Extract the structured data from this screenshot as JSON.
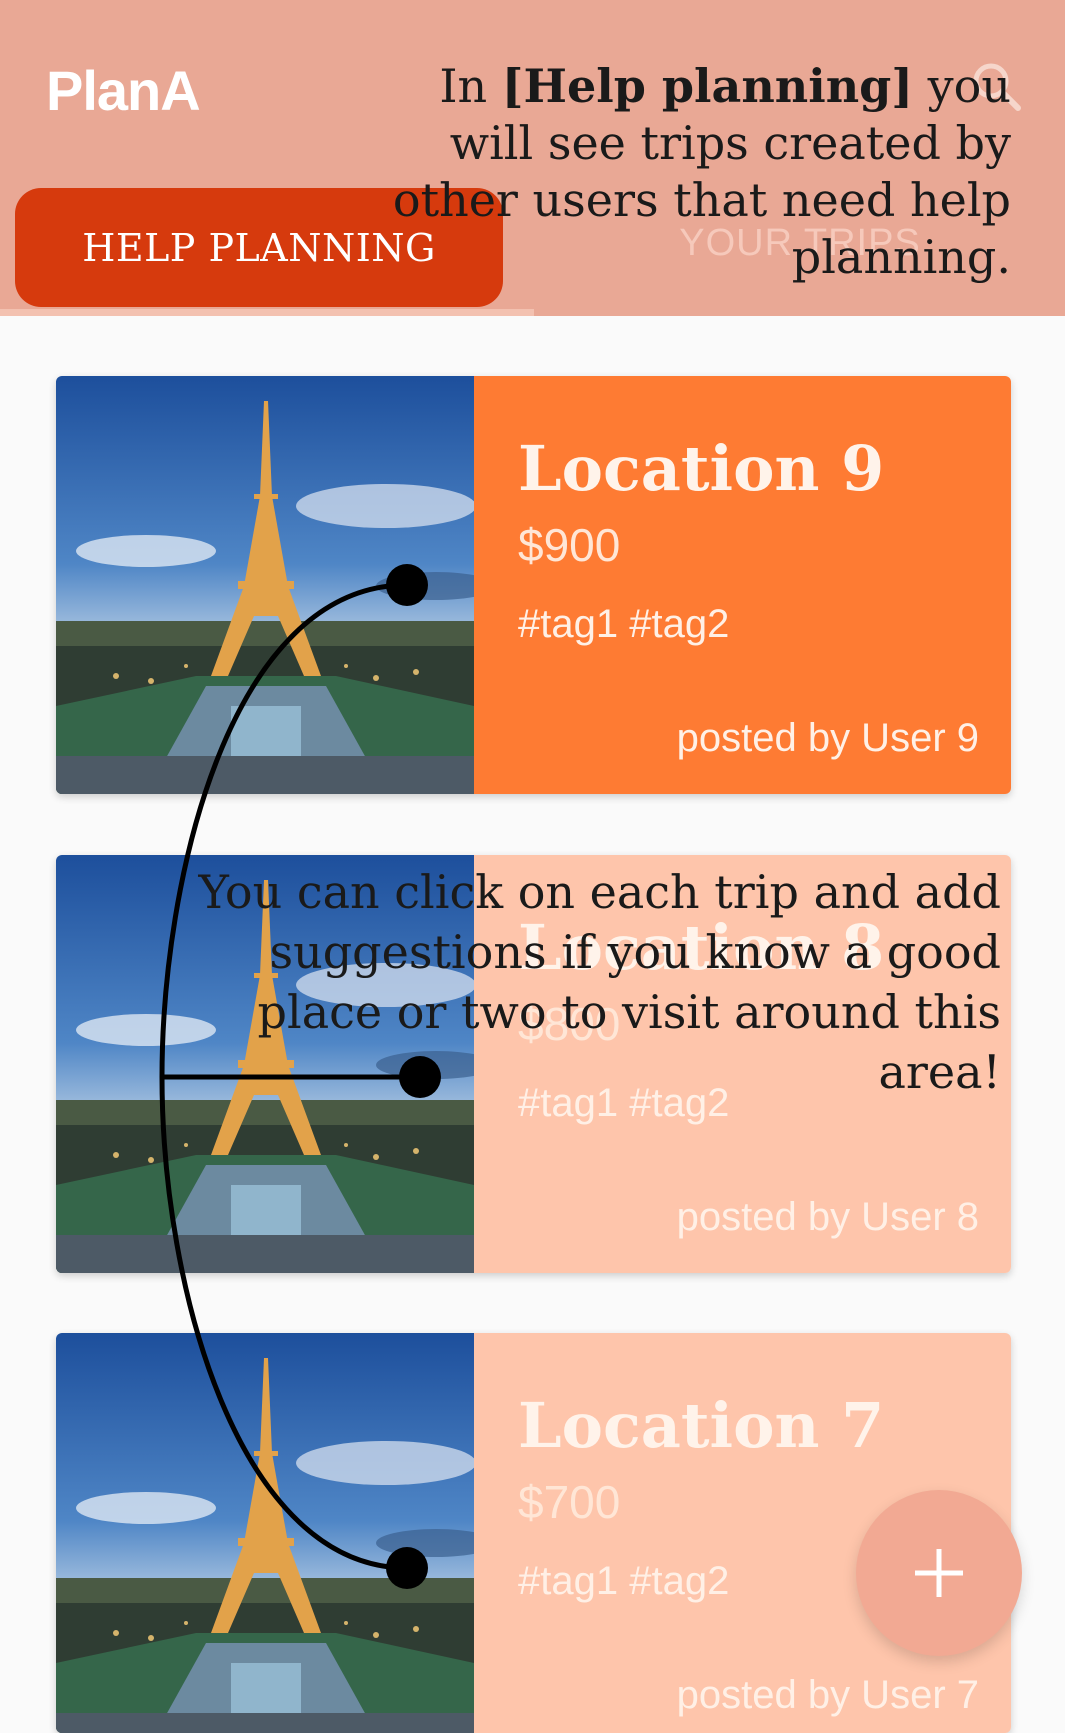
{
  "app": {
    "title": "PlanA"
  },
  "tabs": [
    {
      "label": "HELP PLANNING"
    },
    {
      "label": "YOUR TRIPS"
    }
  ],
  "tutorial": {
    "top_prefix": "In ",
    "top_highlight": "[Help planning]",
    "top_rest": " you will see trips created by other users that need help planning.",
    "middle": "You can click on each trip and add suggestions if you know a good place or two to visit around this area!"
  },
  "trips": [
    {
      "location": "Location 9",
      "price": "$900",
      "tags": "#tag1 #tag2",
      "poster": "posted by User 9"
    },
    {
      "location": "Location 8",
      "price": "$800",
      "tags": "#tag1 #tag2",
      "poster": "posted by User 8"
    },
    {
      "location": "Location 7",
      "price": "$700",
      "tags": "#tag1 #tag2",
      "poster": "posted by User 7"
    }
  ],
  "icons": {
    "search": "search-icon",
    "add": "plus-icon"
  },
  "colors": {
    "accent": "#d63a0d",
    "card_active": "#fe7b33",
    "card_dimmed": "#fec5ab",
    "appbar": "#e9a895"
  }
}
